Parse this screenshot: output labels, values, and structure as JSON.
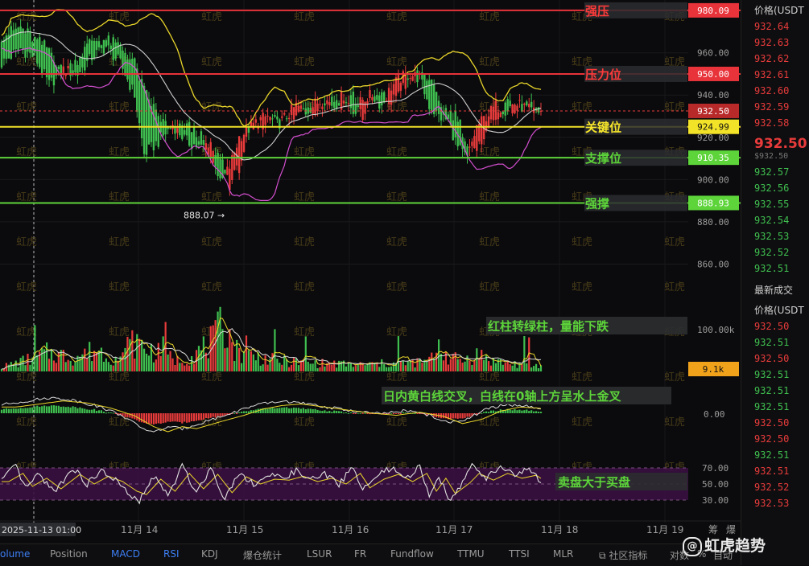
{
  "chart_data": {
    "type": "candlestick",
    "instrument_quote": "USDT",
    "price_axis": {
      "range": [
        848,
        985
      ],
      "ticks": [
        960,
        940,
        920,
        900,
        880,
        860
      ],
      "tick_labels": [
        "960.00",
        "940.00",
        "920.00",
        "900.00",
        "880.00",
        "860.00"
      ]
    },
    "time_axis": {
      "labels": [
        "2025-11-13 01:00",
        "11月 14",
        "11月 15",
        "11月 16",
        "11月 17",
        "11月 18",
        "11月 19"
      ],
      "extra_labels": [
        "筹",
        "爆"
      ]
    },
    "current_price": {
      "value": 932.5,
      "label": "932.50"
    },
    "low_marker": {
      "value": 888.07,
      "label": "888.07 →"
    },
    "levels": [
      {
        "name": "强压",
        "value": 980.09,
        "label": "980.09",
        "color": "#e8333a",
        "text_color": "#ff3b3b",
        "tag_bg": "#e8333a"
      },
      {
        "name": "压力位",
        "value": 950.0,
        "label": "950.00",
        "color": "#e8333a",
        "text_color": "#ff3b3b",
        "tag_bg": "#e8333a"
      },
      {
        "name": "关键位",
        "value": 924.99,
        "label": "924.99",
        "color": "#f2e228",
        "text_color": "#f7e72b",
        "tag_bg": "#f2e228"
      },
      {
        "name": "支撑位",
        "value": 910.35,
        "label": "910.35",
        "color": "#5dd43a",
        "text_color": "#5dd43a",
        "tag_bg": "#5dd43a"
      },
      {
        "name": "强撑",
        "value": 888.93,
        "label": "888.93",
        "color": "#5dd43a",
        "text_color": "#5dd43a",
        "tag_bg": "#5dd43a"
      }
    ],
    "candle_anchors": [
      [
        0,
        955,
        968
      ],
      [
        8,
        962,
        972
      ],
      [
        14,
        958,
        966
      ],
      [
        20,
        945,
        962
      ],
      [
        26,
        952,
        950
      ],
      [
        32,
        950,
        957
      ],
      [
        38,
        958,
        966
      ],
      [
        44,
        963,
        966
      ],
      [
        50,
        955,
        963
      ],
      [
        56,
        940,
        955
      ],
      [
        60,
        912,
        942
      ],
      [
        66,
        918,
        930
      ],
      [
        72,
        926,
        922
      ],
      [
        78,
        918,
        926
      ],
      [
        84,
        915,
        920
      ],
      [
        88,
        918,
        908
      ],
      [
        92,
        898,
        912
      ],
      [
        96,
        906,
        898
      ],
      [
        100,
        920,
        906
      ],
      [
        104,
        924,
        922
      ],
      [
        108,
        928,
        925
      ],
      [
        112,
        930,
        928
      ],
      [
        116,
        926,
        932
      ],
      [
        120,
        930,
        928
      ],
      [
        124,
        935,
        930
      ],
      [
        128,
        932,
        936
      ],
      [
        132,
        936,
        933
      ],
      [
        136,
        938,
        936
      ],
      [
        140,
        935,
        938
      ],
      [
        144,
        940,
        935
      ],
      [
        148,
        932,
        940
      ],
      [
        152,
        938,
        930
      ],
      [
        156,
        940,
        938
      ],
      [
        160,
        935,
        940
      ],
      [
        164,
        944,
        936
      ],
      [
        168,
        948,
        944
      ],
      [
        172,
        950,
        946
      ],
      [
        176,
        948,
        951
      ],
      [
        180,
        935,
        948
      ],
      [
        184,
        930,
        936
      ],
      [
        188,
        928,
        932
      ],
      [
        192,
        915,
        930
      ],
      [
        196,
        910,
        916
      ],
      [
        200,
        925,
        912
      ],
      [
        204,
        930,
        925
      ],
      [
        208,
        935,
        928
      ],
      [
        212,
        933,
        936
      ],
      [
        216,
        936,
        933
      ],
      [
        220,
        934,
        936
      ],
      [
        224,
        932,
        934
      ],
      [
        227,
        932.5,
        932
      ]
    ],
    "volume_axis": {
      "tick_labels": [
        "100.00k"
      ],
      "last_label": "9.1k",
      "last_value": 9100
    },
    "volume_anchors": [
      [
        0,
        8
      ],
      [
        10,
        20
      ],
      [
        20,
        35
      ],
      [
        30,
        25
      ],
      [
        40,
        40
      ],
      [
        50,
        20
      ],
      [
        56,
        55
      ],
      [
        62,
        40
      ],
      [
        68,
        30
      ],
      [
        74,
        20
      ],
      [
        80,
        28
      ],
      [
        86,
        45
      ],
      [
        90,
        60
      ],
      [
        94,
        95
      ],
      [
        98,
        40
      ],
      [
        104,
        30
      ],
      [
        112,
        22
      ],
      [
        120,
        18
      ],
      [
        130,
        15
      ],
      [
        140,
        14
      ],
      [
        150,
        12
      ],
      [
        160,
        14
      ],
      [
        170,
        15
      ],
      [
        180,
        18
      ],
      [
        184,
        52
      ],
      [
        188,
        25
      ],
      [
        194,
        20
      ],
      [
        200,
        32
      ],
      [
        206,
        20
      ],
      [
        214,
        15
      ],
      [
        220,
        12
      ],
      [
        227,
        9.1
      ]
    ],
    "macd": {
      "tick_labels": [
        "0.00"
      ],
      "anchors": [
        [
          0,
          1.2
        ],
        [
          10,
          1.8
        ],
        [
          20,
          2.4
        ],
        [
          30,
          2.0
        ],
        [
          40,
          1.0
        ],
        [
          50,
          -0.5
        ],
        [
          58,
          -2.6
        ],
        [
          64,
          -3.6
        ],
        [
          70,
          -2.6
        ],
        [
          76,
          -3.0
        ],
        [
          82,
          -2.2
        ],
        [
          88,
          -1.4
        ],
        [
          96,
          -0.4
        ],
        [
          104,
          0.8
        ],
        [
          112,
          1.5
        ],
        [
          120,
          1.8
        ],
        [
          130,
          1.2
        ],
        [
          140,
          0.6
        ],
        [
          150,
          0.0
        ],
        [
          160,
          -0.4
        ],
        [
          170,
          0.2
        ],
        [
          180,
          -0.6
        ],
        [
          188,
          -2.0
        ],
        [
          196,
          -1.2
        ],
        [
          204,
          0.4
        ],
        [
          212,
          1.2
        ],
        [
          220,
          1.0
        ],
        [
          227,
          0.3
        ]
      ]
    },
    "rsi": {
      "tick_labels": [
        "70.00",
        "50.00",
        "30.00"
      ],
      "band": [
        30,
        70
      ],
      "anchors": [
        [
          0,
          55
        ],
        [
          6,
          72
        ],
        [
          10,
          45
        ],
        [
          16,
          62
        ],
        [
          22,
          40
        ],
        [
          30,
          70
        ],
        [
          36,
          50
        ],
        [
          42,
          66
        ],
        [
          48,
          55
        ],
        [
          54,
          35
        ],
        [
          58,
          28
        ],
        [
          64,
          60
        ],
        [
          70,
          35
        ],
        [
          76,
          72
        ],
        [
          82,
          40
        ],
        [
          88,
          70
        ],
        [
          94,
          32
        ],
        [
          100,
          65
        ],
        [
          106,
          50
        ],
        [
          112,
          60
        ],
        [
          118,
          58
        ],
        [
          124,
          66
        ],
        [
          130,
          55
        ],
        [
          136,
          62
        ],
        [
          142,
          50
        ],
        [
          148,
          72
        ],
        [
          152,
          42
        ],
        [
          158,
          60
        ],
        [
          164,
          70
        ],
        [
          170,
          55
        ],
        [
          176,
          72
        ],
        [
          180,
          35
        ],
        [
          184,
          62
        ],
        [
          188,
          30
        ],
        [
          194,
          52
        ],
        [
          198,
          72
        ],
        [
          204,
          58
        ],
        [
          210,
          72
        ],
        [
          216,
          62
        ],
        [
          222,
          68
        ],
        [
          227,
          52
        ]
      ]
    }
  },
  "annotations": {
    "volume_note": "红柱转绿柱，量能下跌",
    "macd_note": "日内黄白线交叉，白线在0轴上方呈水上金叉",
    "rsi_note": "卖盘大于买盘"
  },
  "watermark_text": "虹虎",
  "right_panel": {
    "price_title": "价格(USDT",
    "asks": [
      "932.64",
      "932.63",
      "932.62",
      "932.61",
      "932.60",
      "932.59",
      "932.58"
    ],
    "last_price": "932.50",
    "last_sub": "$932.50",
    "bids": [
      "932.57",
      "932.56",
      "932.55",
      "932.54",
      "932.53",
      "932.52",
      "932.51"
    ],
    "trades_title": "最新成交",
    "trades_price_title": "价格(USDT",
    "trades": [
      {
        "p": "932.50",
        "c": "#e83b3b"
      },
      {
        "p": "932.51",
        "c": "#3fbf4f"
      },
      {
        "p": "932.50",
        "c": "#e83b3b"
      },
      {
        "p": "932.51",
        "c": "#3fbf4f"
      },
      {
        "p": "932.51",
        "c": "#3fbf4f"
      },
      {
        "p": "932.51",
        "c": "#3fbf4f"
      },
      {
        "p": "932.50",
        "c": "#e83b3b"
      },
      {
        "p": "932.50",
        "c": "#e83b3b"
      },
      {
        "p": "932.51",
        "c": "#3fbf4f"
      },
      {
        "p": "932.51",
        "c": "#e83b3b"
      },
      {
        "p": "932.52",
        "c": "#e83b3b"
      },
      {
        "p": "932.53",
        "c": "#e83b3b"
      }
    ]
  },
  "bottom_tabs": [
    "olume",
    "Position",
    "MACD",
    "RSI",
    "KDJ",
    "爆仓统计",
    "LSUR",
    "FR",
    "Fundflow",
    "TTMU",
    "TTSI",
    "MLR",
    "⧉ 社区指标",
    "对数",
    "%",
    "自动"
  ],
  "brand": {
    "logo_text": "虹虎趋势",
    "logo_glyph": "@"
  },
  "colors": {
    "up": "#3fbf4f",
    "down": "#e83b3b",
    "bg": "#0b0b0d",
    "accent": "#3d7ff5"
  }
}
